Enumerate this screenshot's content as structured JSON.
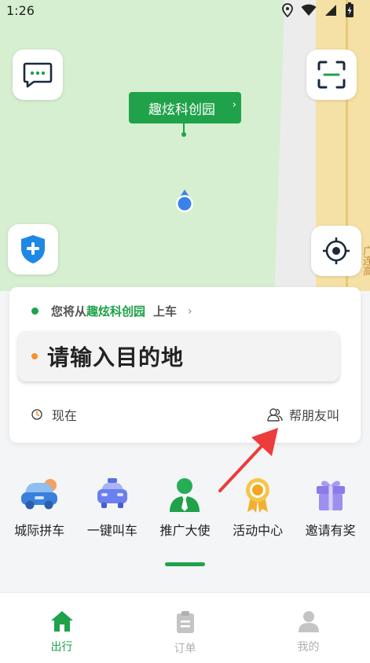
{
  "status_bar": {
    "time": "1:26"
  },
  "map": {
    "poi_label": "趣炫科创园",
    "poi_chevron": "›",
    "road_label": "广连高",
    "road_label_extra": "大"
  },
  "trip": {
    "pickup_prefix": "您将从",
    "pickup_place": "趣炫科创园",
    "pickup_suffix": "上车",
    "pickup_chevron": "›",
    "destination_placeholder": "请输入目的地",
    "time_label": "现在",
    "call_for_friend_label": "帮朋友叫"
  },
  "services": [
    {
      "label": "城际拼车",
      "icon": "intercity-carpool-icon"
    },
    {
      "label": "一键叫车",
      "icon": "taxi-icon"
    },
    {
      "label": "推广大使",
      "icon": "ambassador-icon"
    },
    {
      "label": "活动中心",
      "icon": "medal-icon"
    },
    {
      "label": "邀请有奖",
      "icon": "gift-icon"
    }
  ],
  "bottom_nav": [
    {
      "label": "出行",
      "icon": "home-icon",
      "active": true
    },
    {
      "label": "订单",
      "icon": "clipboard-icon",
      "active": false
    },
    {
      "label": "我的",
      "icon": "user-icon",
      "active": false
    }
  ],
  "colors": {
    "accent": "#1fa24a",
    "destination_dot": "#f5922b",
    "shield": "#1e88e5"
  }
}
